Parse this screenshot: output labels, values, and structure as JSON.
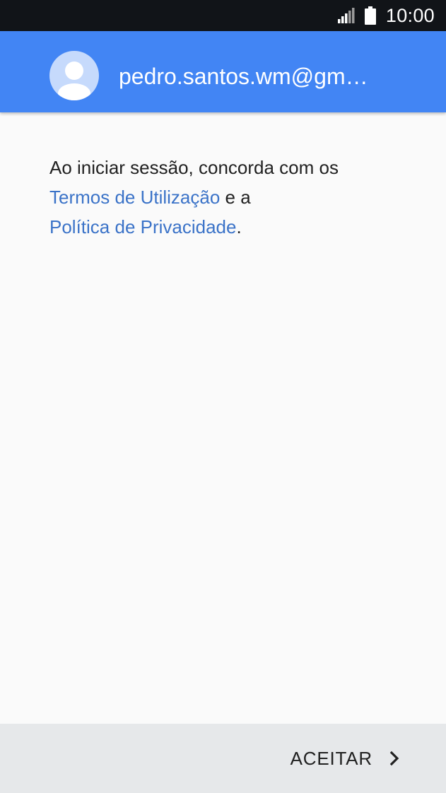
{
  "status_bar": {
    "time": "10:00",
    "icons": [
      "signal-icon",
      "battery-icon"
    ]
  },
  "account": {
    "email": "pedro.santos.wm@gm…",
    "avatar_icon": "person-icon"
  },
  "terms": {
    "intro": "Ao iniciar sessão, concorda com os",
    "terms_link": "Termos de Utilização",
    "conjunction": " e a",
    "privacy_link": "Política de Privacidade",
    "end": "."
  },
  "footer": {
    "accept_label": "ACEITAR",
    "accept_icon": "chevron-right-icon"
  },
  "colors": {
    "accent": "#4285f4",
    "link": "#3b73c8",
    "status_bar": "#111418",
    "footer": "#e6e8ea"
  }
}
